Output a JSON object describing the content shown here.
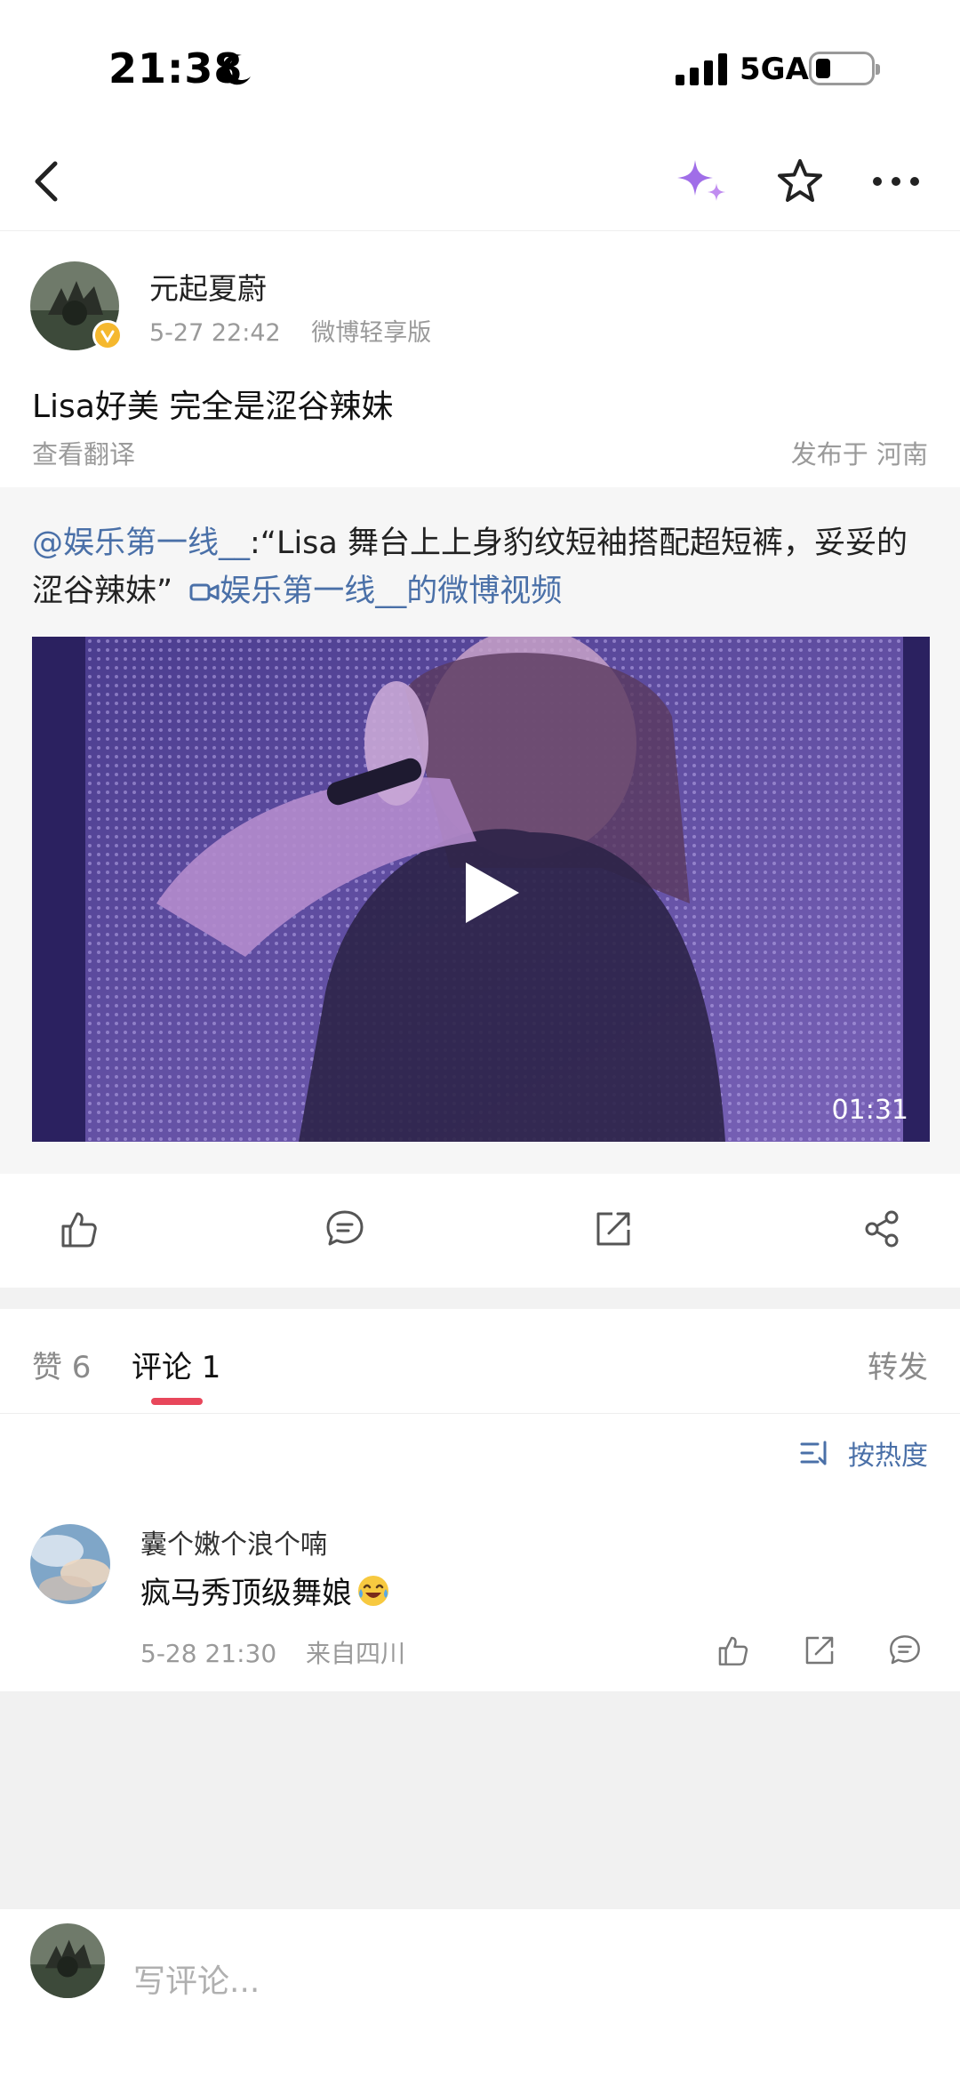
{
  "status_bar": {
    "time": "21:38",
    "network": "5GA",
    "icons": [
      "moon-icon",
      "signal-icon",
      "battery-icon"
    ]
  },
  "nav": {
    "icons": [
      "back-icon",
      "sparkle-icon",
      "star-icon",
      "more-icon"
    ]
  },
  "post": {
    "author": "元起夏蔚",
    "date": "5-27 22:42",
    "source": "微博轻享版",
    "text": "Lisa好美 完全是涩谷辣妹",
    "translate_label": "查看翻译",
    "location": "发布于 河南"
  },
  "repost": {
    "mention": "@娱乐第一线__",
    "quote": ":“Lisa 舞台上上身豹纹短袖搭配超短裤，妥妥的涩谷辣妹”",
    "video_link": "娱乐第一线__的微博视频",
    "video_duration": "01:31"
  },
  "actions": {
    "icons": [
      "like-icon",
      "comment-icon",
      "repost-icon",
      "share-icon"
    ]
  },
  "tabs": {
    "likes": "赞 6",
    "comments": "评论 1",
    "reposts": "转发",
    "accent_color": "#e8475b"
  },
  "sort": {
    "label": "按热度"
  },
  "comment": {
    "author": "囊个嫩个浪个喃",
    "text": "疯马秀顶级舞娘",
    "emoji": "laughing-crying-emoji",
    "date": "5-28 21:30",
    "location": "来自四川"
  },
  "composer": {
    "placeholder": "写评论..."
  },
  "colors": {
    "link": "#4a70a8",
    "muted": "#9a9a9a",
    "sparkle": "#a06ee8"
  }
}
